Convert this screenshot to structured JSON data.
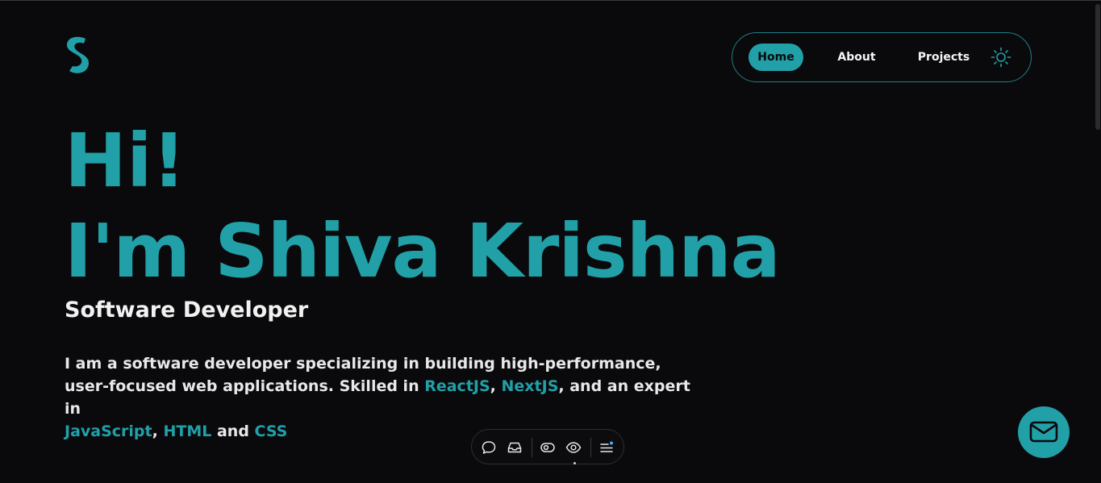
{
  "logo": {
    "icon": "s-logo-icon",
    "color": "#21a0a8"
  },
  "nav": {
    "items": [
      {
        "label": "Home",
        "active": true
      },
      {
        "label": "About",
        "active": false
      },
      {
        "label": "Projects",
        "active": false
      }
    ],
    "theme_icon": "sun-icon"
  },
  "hero": {
    "greeting": "Hi!",
    "name": "I'm Shiva Krishna",
    "role": "Software Developer",
    "bio": {
      "part1": "I am a software developer specializing in building high-performance, user-focused web applications. Skilled in ",
      "react": "ReactJS",
      "comma1": ", ",
      "next": "NextJS",
      "part2": ", and an expert in ",
      "js": "JavaScript",
      "comma2": ", ",
      "html": "HTML",
      "and": " and ",
      "css": "CSS"
    }
  },
  "toolbar": {
    "icons": [
      "comment-icon",
      "inbox-icon",
      "toggle-visibility-icon",
      "eye-icon",
      "menu-icon"
    ]
  },
  "fab": {
    "icon": "mail-icon"
  },
  "colors": {
    "accent": "#21a0a8",
    "background": "#0a0a0c",
    "text": "#f2f2f2"
  }
}
